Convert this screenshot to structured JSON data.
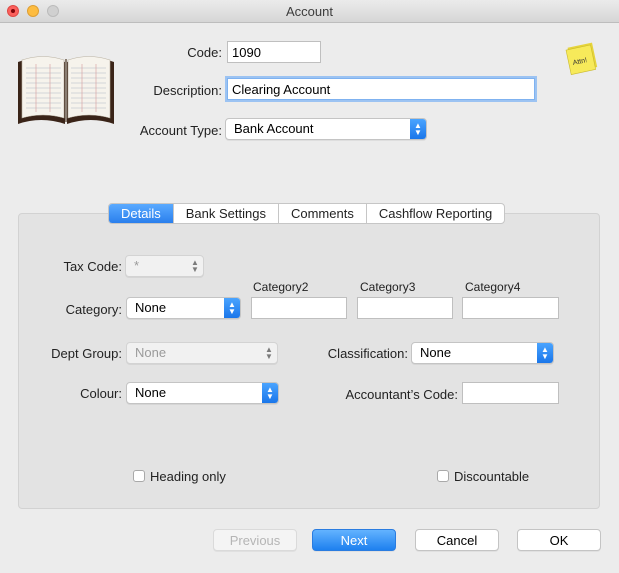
{
  "window": {
    "title": "Account"
  },
  "header": {
    "code_label": "Code:",
    "code_value": "1090",
    "description_label": "Description:",
    "description_value": "Clearing Account",
    "account_type_label": "Account Type:",
    "account_type_value": "Bank Account",
    "note_icon_text": "Attn!"
  },
  "tabs": [
    {
      "label": "Details",
      "active": true
    },
    {
      "label": "Bank Settings",
      "active": false
    },
    {
      "label": "Comments",
      "active": false
    },
    {
      "label": "Cashflow Reporting",
      "active": false
    }
  ],
  "details": {
    "tax_code_label": "Tax Code:",
    "tax_code_value": "*",
    "category_label": "Category:",
    "category_value": "None",
    "category2_label": "Category2",
    "category3_label": "Category3",
    "category4_label": "Category4",
    "category2_value": "",
    "category3_value": "",
    "category4_value": "",
    "dept_group_label": "Dept Group:",
    "dept_group_value": "None",
    "classification_label": "Classification:",
    "classification_value": "None",
    "colour_label": "Colour:",
    "colour_value": "None",
    "accountants_code_label": "Accountant’s Code:",
    "accountants_code_value": "",
    "heading_only_label": "Heading only",
    "heading_only_checked": false,
    "discountable_label": "Discountable",
    "discountable_checked": false
  },
  "footer": {
    "previous_label": "Previous",
    "next_label": "Next",
    "cancel_label": "Cancel",
    "ok_label": "OK"
  },
  "colors": {
    "accent": "#2a7fed",
    "panel": "#e3e3e3",
    "window": "#ececec"
  },
  "icons": [
    "close-icon",
    "minimize-icon",
    "zoom-icon",
    "ledger-book-icon",
    "sticky-note-icon",
    "chevron-updown-icon"
  ]
}
